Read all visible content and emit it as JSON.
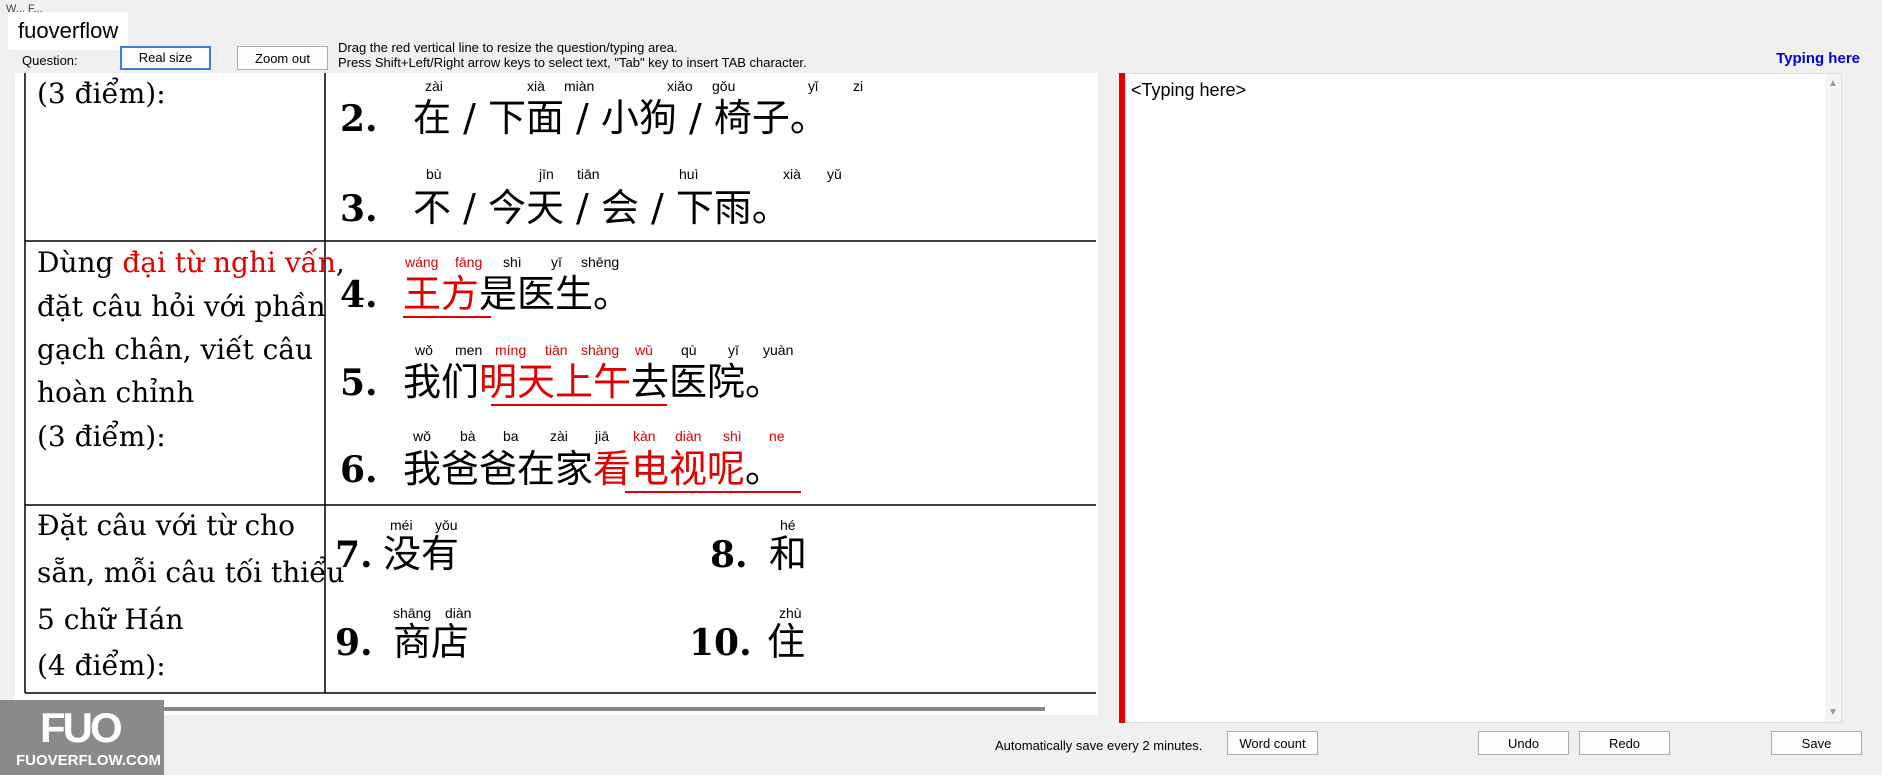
{
  "window": {
    "tab_title": "W... F..."
  },
  "brand": "fuoverflow",
  "toolbar": {
    "question_label": "Question:",
    "real_size": "Real size",
    "zoom_out": "Zoom out",
    "hint_line1": "Drag the red vertical line to resize the question/typing area.",
    "hint_line2": "Press Shift+Left/Right arrow keys to select text, \"Tab\" key to insert TAB character.",
    "typing_title": "Typing here"
  },
  "question": {
    "row1_left": "(3 điểm):",
    "row2_left_lines": [
      "Dùng ",
      "đại từ nghi vấn",
      ",",
      "đặt câu hỏi với phần",
      "gạch chân, viết câu",
      "hoàn chỉnh",
      "(3 điểm):"
    ],
    "row3_left_lines": [
      "Đặt câu với từ cho",
      "sẵn, mỗi câu tối thiểu",
      "5 chữ Hán",
      "(4 điểm):"
    ],
    "items": [
      {
        "num": "2.",
        "pinyin": [
          "zài",
          "xià",
          "miàn",
          "xiǎo",
          "gǒu",
          "yǐ",
          "zi"
        ],
        "text": "在 / 下面 / 小狗 / 椅子。"
      },
      {
        "num": "3.",
        "pinyin": [
          "bù",
          "jīn",
          "tiān",
          "huì",
          "xià",
          "yǔ"
        ],
        "text": "不  / 今天 / 会 /  下雨。"
      },
      {
        "num": "4.",
        "pinyin_red": [
          "wáng",
          "fāng"
        ],
        "pinyin": [
          "shì",
          "yī",
          "shēng"
        ],
        "red": "王方",
        "text": "是医生。"
      },
      {
        "num": "5.",
        "pinyin": [
          "wǒ",
          "men",
          "qù",
          "yī",
          "yuàn"
        ],
        "pinyin_red": [
          "míng",
          "tiān",
          "shàng",
          "wǔ"
        ],
        "pre": "我们",
        "red": "明天上午",
        "text": "去医院。"
      },
      {
        "num": "6.",
        "pinyin": [
          "wǒ",
          "bà",
          "ba",
          "zài",
          "jiā"
        ],
        "pinyin_red": [
          "kàn",
          "diàn",
          "shì",
          "ne"
        ],
        "pre": "我爸爸在家",
        "red": "看电视呢",
        "text": "。"
      },
      {
        "num": "7.",
        "pinyin": [
          "méi",
          "yǒu"
        ],
        "text": "没有"
      },
      {
        "num": "8.",
        "pinyin": [
          "hé"
        ],
        "text": "和"
      },
      {
        "num": "9.",
        "pinyin": [
          "shāng",
          "diàn"
        ],
        "text": "商店"
      },
      {
        "num": "10.",
        "pinyin": [
          "zhù"
        ],
        "text": "住"
      }
    ]
  },
  "editor": {
    "placeholder": "<Typing here>"
  },
  "status": {
    "autosave": "Automatically save every 2 minutes.",
    "word_count": "Word count",
    "undo": "Undo",
    "redo": "Redo",
    "save": "Save"
  },
  "logo": {
    "mark": "FUO",
    "site": "FUOVERFLOW.COM"
  },
  "colors": {
    "accent_red": "#e00000",
    "typing_title": "#0000dd"
  }
}
